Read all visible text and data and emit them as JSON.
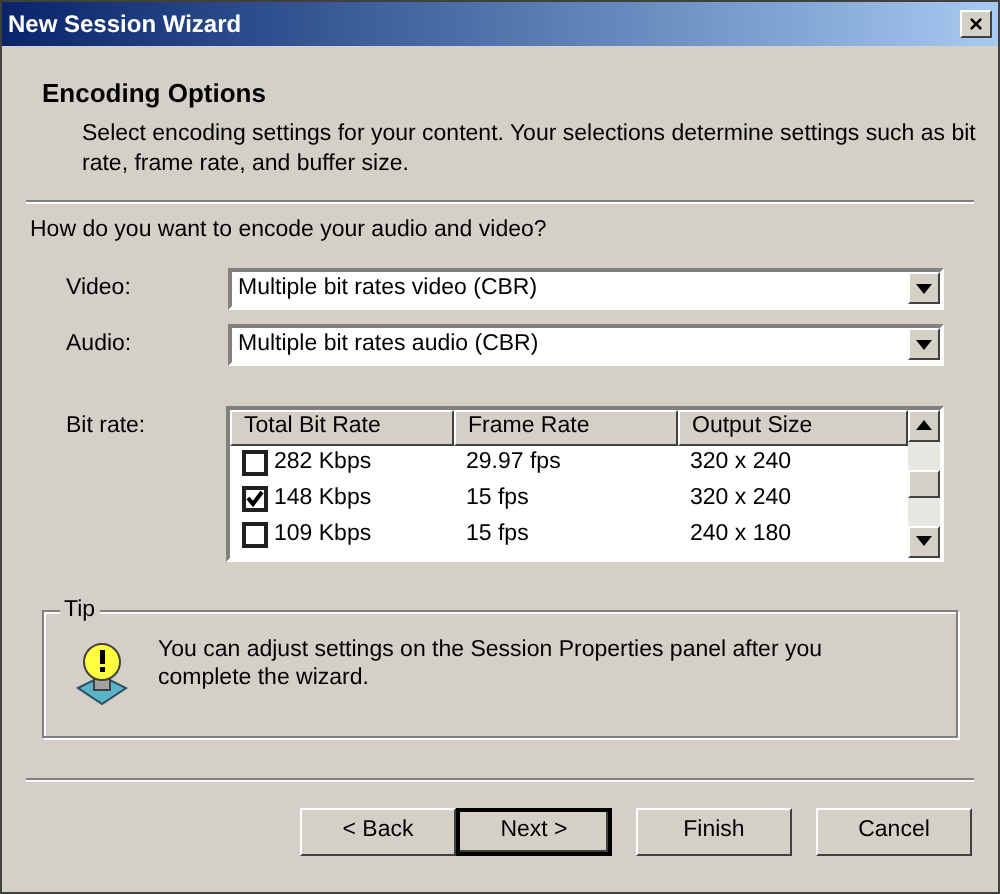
{
  "window": {
    "title": "New Session Wizard",
    "close": "×"
  },
  "header": {
    "title": "Encoding Options",
    "description": "Select encoding settings for your content. Your selections determine settings such as bit rate, frame rate, and buffer size."
  },
  "question": "How do you want to encode your audio and video?",
  "fields": [
    {
      "label": "Video:",
      "value": "Multiple bit rates video (CBR)"
    },
    {
      "label": "Audio:",
      "value": "Multiple bit rates audio (CBR)"
    }
  ],
  "bitrate": {
    "label": "Bit rate:",
    "columns": [
      "Total Bit Rate",
      "Frame Rate",
      "Output Size"
    ],
    "rows": [
      {
        "checked": false,
        "cells": [
          "282 Kbps",
          "29.97 fps",
          "320 x 240"
        ]
      },
      {
        "checked": true,
        "cells": [
          "148 Kbps",
          "15 fps",
          "320 x 240"
        ]
      },
      {
        "checked": false,
        "cells": [
          "109 Kbps",
          "15 fps",
          "240 x 180"
        ]
      }
    ]
  },
  "tip": {
    "title": "Tip",
    "text": "You can adjust settings on the Session Properties panel after you complete the wizard."
  },
  "buttons": [
    {
      "label": "< Back",
      "default": false
    },
    {
      "label": "Next >",
      "default": true
    },
    {
      "label": "Finish",
      "default": false
    },
    {
      "label": "Cancel",
      "default": false
    }
  ]
}
